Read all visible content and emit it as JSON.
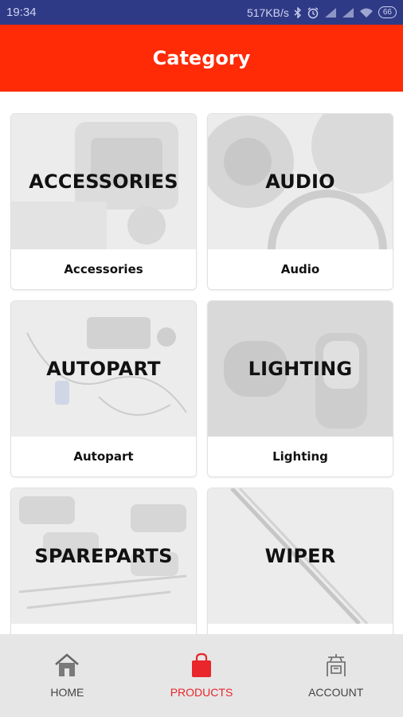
{
  "status_bar": {
    "time": "19:34",
    "network_speed": "517KB/s",
    "battery": "66",
    "icons": [
      "bluetooth-icon",
      "alarm-icon",
      "signal-icon",
      "signal-icon",
      "wifi-icon",
      "battery-icon"
    ]
  },
  "app_bar": {
    "title": "Category"
  },
  "categories": [
    {
      "overlay": "ACCESSORIES",
      "label": "Accessories"
    },
    {
      "overlay": "AUDIO",
      "label": "Audio"
    },
    {
      "overlay": "AUTOPART",
      "label": "Autopart"
    },
    {
      "overlay": "LIGHTING",
      "label": "Lighting"
    },
    {
      "overlay": "SPAREPARTS",
      "label": ""
    },
    {
      "overlay": "WIPER",
      "label": ""
    }
  ],
  "bottom_nav": {
    "items": [
      {
        "label": "HOME",
        "icon": "home-icon",
        "active": false
      },
      {
        "label": "PRODUCTS",
        "icon": "shopping-bag-icon",
        "active": true
      },
      {
        "label": "ACCOUNT",
        "icon": "account-icon",
        "active": false
      }
    ]
  },
  "colors": {
    "status_bar": "#2f3a86",
    "app_bar": "#ff2a06",
    "active_nav": "#e8262b",
    "bottom_nav_bg": "#e6e6e6"
  }
}
